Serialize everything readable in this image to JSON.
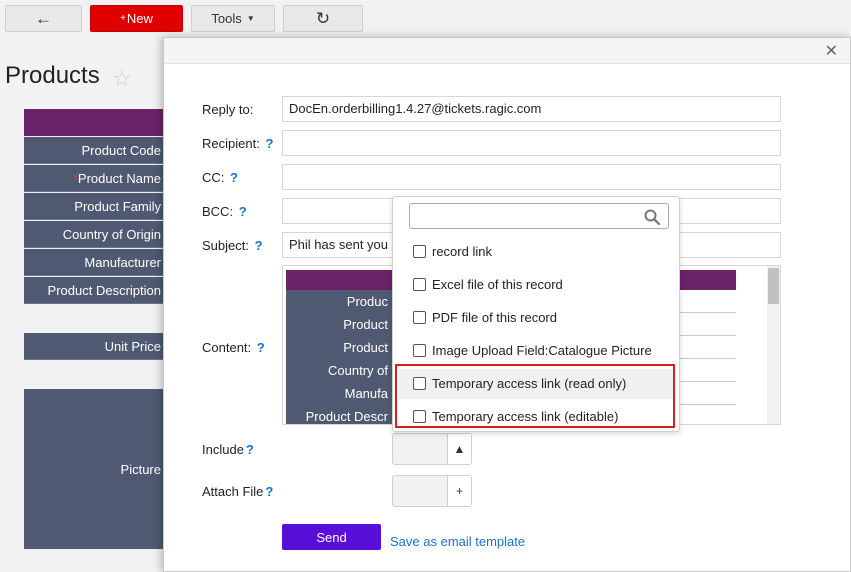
{
  "toolbar": {
    "back_icon": "arrow-left-icon",
    "new_plus": "+",
    "new_label": "New",
    "tools_label": "Tools",
    "refresh_icon": "refresh-icon"
  },
  "page": {
    "title": "Products"
  },
  "form": {
    "fields": [
      {
        "label": "Product Code",
        "required": false
      },
      {
        "label": "Product Name",
        "required": true
      },
      {
        "label": "Product Family",
        "required": false
      },
      {
        "label": "Country of Origin",
        "required": false
      },
      {
        "label": "Manufacturer",
        "required": false
      },
      {
        "label": "Product Description",
        "required": false
      }
    ],
    "unit_price": "Unit Price",
    "picture": "Picture",
    "required_mark": "*"
  },
  "dialog": {
    "reply_to_label": "Reply to:",
    "reply_to_value": "DocEn.orderbilling1.4.27@tickets.ragic.com",
    "recipient_label": "Recipient:",
    "cc_label": "CC:",
    "bcc_label": "BCC:",
    "subject_label": "Subject:",
    "subject_value": "Phil has sent you",
    "content_label": "Content:",
    "help_mark": "?",
    "include_label": "Include",
    "attach_label": "Attach File",
    "send_label": "Send",
    "save_template_label": "Save as email template",
    "close_icon": "close-icon",
    "preview_labels": [
      "Produc",
      "Product",
      "Product",
      "Country of",
      "Manufa",
      "Product Descr"
    ],
    "include_stepper": "▲",
    "attach_stepper": "+"
  },
  "dropdown": {
    "search_placeholder": "",
    "options": [
      "record link",
      "Excel file of this record",
      "PDF file of this record",
      "Image Upload Field:Catalogue Picture",
      "Temporary access link (read only)",
      "Temporary access link (editable)"
    ]
  },
  "colors": {
    "new_button": "#e00000",
    "form_header": "#6a2268",
    "field_label_bg": "#4f5a72",
    "send_button": "#5a0fd8",
    "link": "#1a73c8",
    "highlight": "#d71e1e"
  }
}
